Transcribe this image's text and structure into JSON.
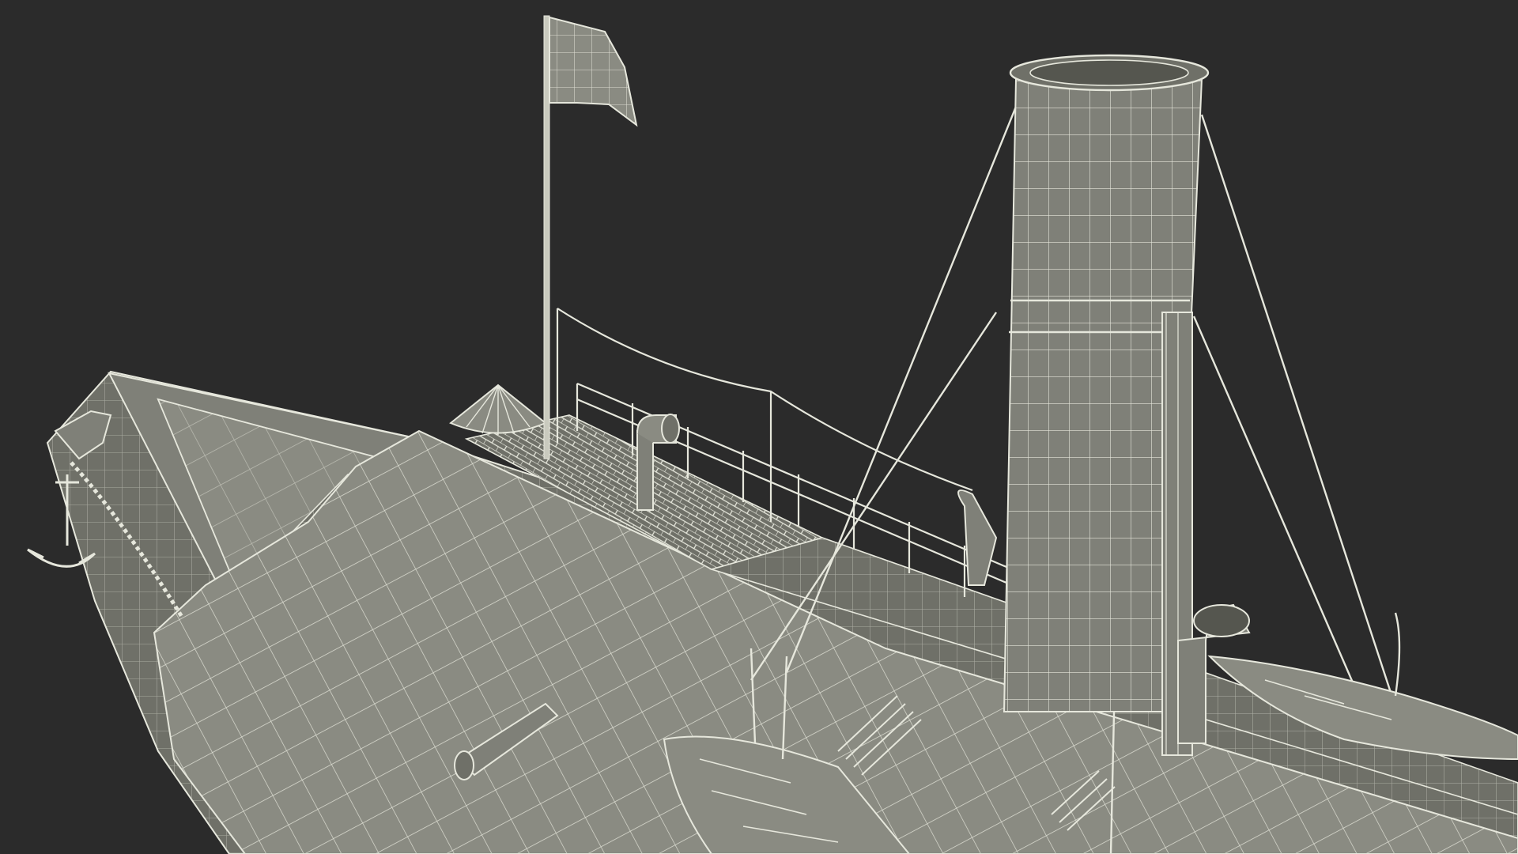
{
  "scene": {
    "subject": "wireframe-steamship-model",
    "colors": {
      "background": "#2b2b2b",
      "hull_fill": "#7f8078",
      "deck_fill": "#8a8b82",
      "deck_dark": "#6f7068",
      "wire": "#e6e7dc",
      "wire_dim": "#c9cabe",
      "shadow": "#55564f"
    },
    "icons": [
      "flag-icon",
      "anchor-icon",
      "funnel-icon",
      "lifeboat-icon",
      "ventilator-icon"
    ]
  }
}
